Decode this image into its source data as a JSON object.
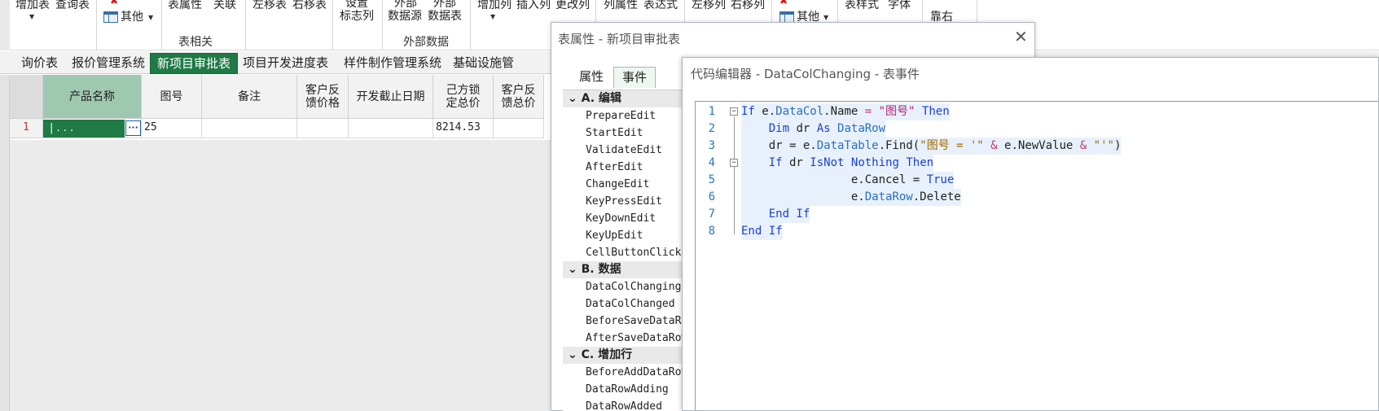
{
  "ribbon": {
    "buttons": {
      "add_table": "增加表",
      "query_table": "查询表",
      "other1": "其他",
      "table_props": "表属性",
      "relation": "关联",
      "move_left": "左移表",
      "move_right": "右移表",
      "set_flag_line1": "设置",
      "set_flag_line2": "标志列",
      "ext_source_line1": "外部",
      "ext_source_line2": "数据源",
      "ext_table_line1": "外部",
      "ext_table_line2": "数据表",
      "add_col": "增加列",
      "insert_col": "插入列",
      "change_col": "更改列",
      "col_props": "列属性",
      "expression": "表达式",
      "move_col_left": "左移列",
      "move_col_right": "右移列",
      "other2": "其他",
      "table_style": "表样式",
      "font": "字体",
      "align_right": "靠右"
    },
    "groups": {
      "table_related": "表相关",
      "external_data": "外部数据"
    }
  },
  "tabs": [
    "询价表",
    "报价管理系统",
    "新项目审批表",
    "项目开发进度表",
    "样件制作管理系统",
    "基础设施管"
  ],
  "active_tab": "新项目审批表",
  "grid": {
    "headers": [
      "产品名称",
      "图号",
      "备注",
      "客户反\n馈价格",
      "开发截止日期",
      "己方锁\n定总价",
      "客户反\n馈总价"
    ],
    "row_number": "1",
    "editing_value": "| . . .",
    "row": [
      "",
      "25",
      "",
      "",
      "",
      "8214.53",
      ""
    ]
  },
  "table_props_dialog": {
    "title": "表属性 - 新项目审批表",
    "tabs": [
      "属性",
      "事件"
    ],
    "active_tab": "事件",
    "categories": [
      {
        "name": "A. 编辑",
        "items": [
          "PrepareEdit",
          "StartEdit",
          "ValidateEdit",
          "AfterEdit",
          "ChangeEdit",
          "KeyPressEdit",
          "KeyDownEdit",
          "KeyUpEdit",
          "CellButtonClick"
        ]
      },
      {
        "name": "B. 数据",
        "items": [
          "DataColChanging",
          "DataColChanged",
          "BeforeSaveDataRo",
          "AfterSaveDataRow"
        ]
      },
      {
        "name": "C. 增加行",
        "items": [
          "BeforeAddDataRow",
          "DataRowAdding",
          "DataRowAdded"
        ]
      }
    ]
  },
  "code_editor": {
    "title": "代码编辑器 - DataColChanging - 表事件",
    "line_numbers": [
      "1",
      "2",
      "3",
      "4",
      "5",
      "6",
      "7",
      "8"
    ],
    "lines": [
      "If e.DataCol.Name = \"图号\" Then",
      "    Dim dr As DataRow",
      "    dr = e.DataTable.Find(\"图号 = '\" & e.NewValue & \"'\")",
      "    If dr IsNot Nothing Then",
      "                e.Cancel = True",
      "                e.DataRow.Delete",
      "    End If",
      "End If"
    ]
  },
  "colors": {
    "accent_green": "#1f7a45",
    "keyword_blue": "#1a3fd6",
    "string_magenta": "#b0207a",
    "row_number_red": "#c0392b"
  }
}
